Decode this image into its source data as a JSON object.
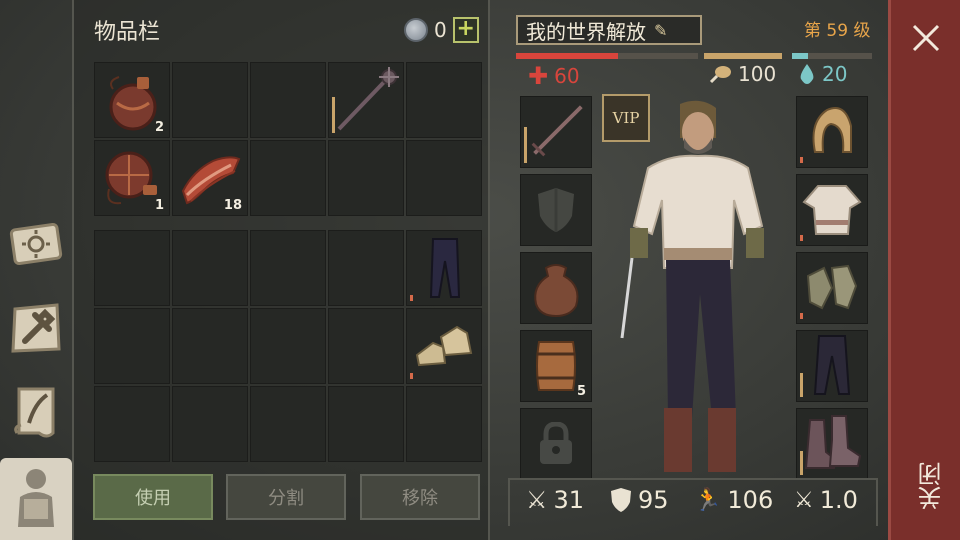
{
  "inventory": {
    "title": "物品栏",
    "coins": "0",
    "add_coins_label": "+",
    "slots": [
      {
        "icon": "canteen-icon",
        "count": "2"
      },
      {
        "icon": "",
        "count": ""
      },
      {
        "icon": "",
        "count": ""
      },
      {
        "icon": "mace-icon",
        "count": ""
      },
      {
        "icon": "",
        "count": ""
      },
      {
        "icon": "canteen-icon",
        "count": "1"
      },
      {
        "icon": "bacon-icon",
        "count": "18"
      }
    ],
    "bag_slots": [
      {
        "icon": "trousers-icon"
      },
      {
        "icon": "shoes-icon"
      }
    ],
    "buttons": {
      "use": "使用",
      "split": "分割",
      "remove": "移除"
    }
  },
  "character": {
    "name": "我的世界解放",
    "level": "第 59 级",
    "health": "60",
    "hunger": "100",
    "thirst": "20",
    "vip_label": "VIP",
    "left_slots": [
      {
        "icon": "sword-icon",
        "count": ""
      },
      {
        "icon": "shield-icon",
        "count": ""
      },
      {
        "icon": "sack-icon",
        "count": ""
      },
      {
        "icon": "barrel-icon",
        "count": "5"
      },
      {
        "icon": "lock-icon",
        "count": ""
      }
    ],
    "right_slots": [
      {
        "icon": "hood-icon"
      },
      {
        "icon": "shirt-icon"
      },
      {
        "icon": "gloves-icon"
      },
      {
        "icon": "trousers-icon"
      },
      {
        "icon": "boots-icon"
      }
    ],
    "stats": {
      "attack": "31",
      "defense": "95",
      "speed": "106",
      "attack_speed": "1.0"
    }
  },
  "close_label": "关闭",
  "colors": {
    "health": "#d9453c",
    "hunger": "#c9a46a",
    "thirst": "#7cc7c7",
    "level": "#e8a54a",
    "close_bg": "#7a2f2b"
  }
}
